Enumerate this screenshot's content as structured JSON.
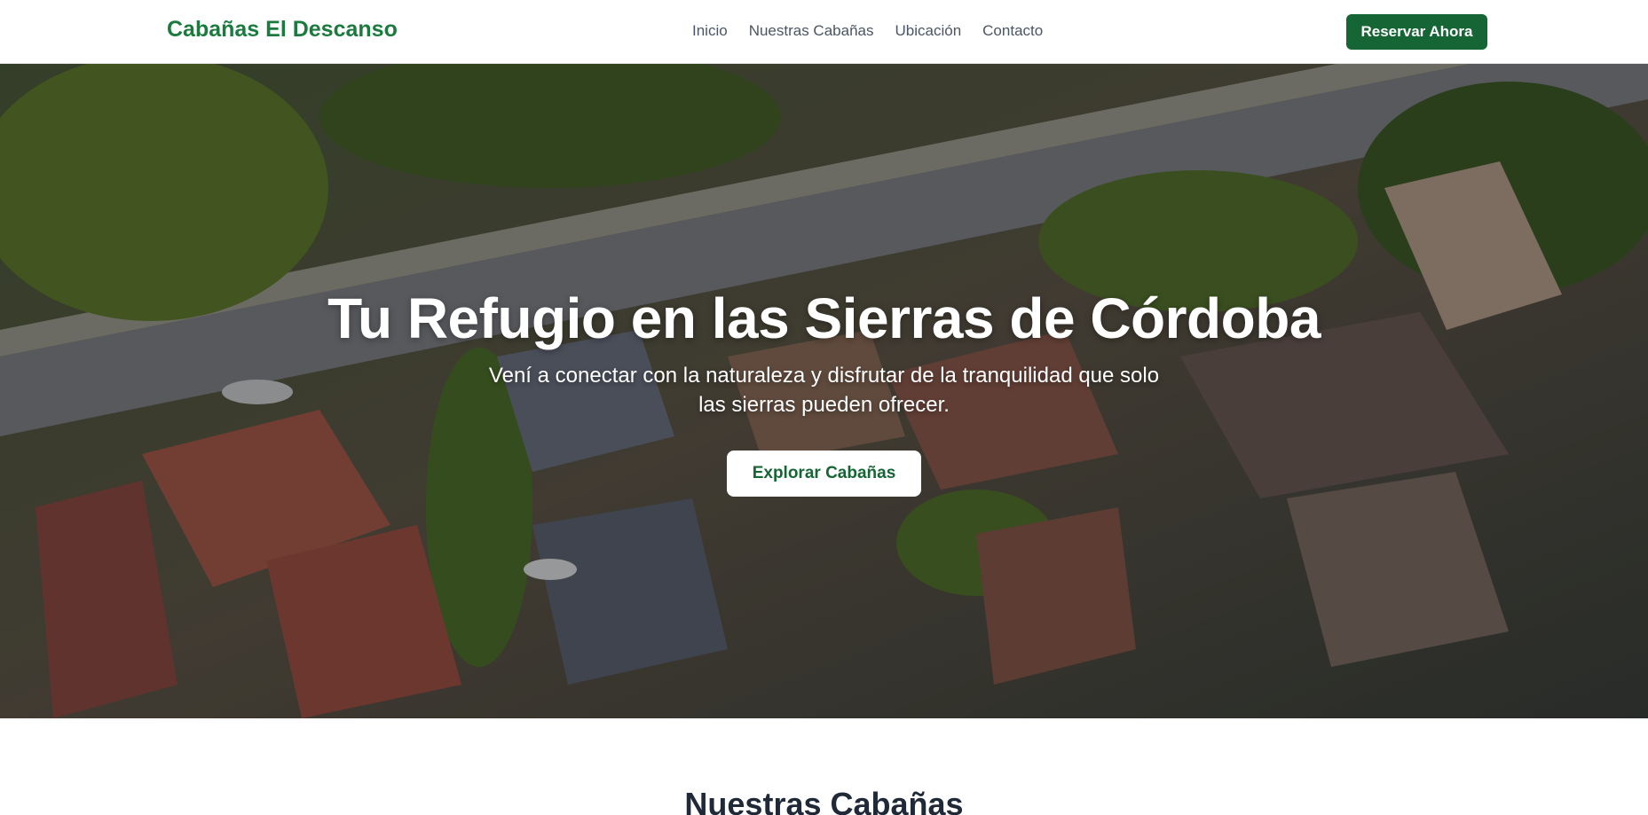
{
  "navbar": {
    "brand": "Cabañas El Descanso",
    "links": [
      "Inicio",
      "Nuestras Cabañas",
      "Ubicación",
      "Contacto"
    ],
    "cta_label": "Reservar Ahora"
  },
  "hero": {
    "title": "Tu Refugio en las Sierras de Córdoba",
    "subtitle": "Vení a conectar con la naturaleza y disfrutar de la tranquilidad que solo las sierras pueden ofrecer.",
    "cta_label": "Explorar Cabañas",
    "background_image": "aerial-neighborhood-photo"
  },
  "section": {
    "title": "Nuestras Cabañas"
  },
  "colors": {
    "brand_green": "#1b7a3e",
    "button_green": "#166534",
    "nav_text": "#4b5563"
  }
}
